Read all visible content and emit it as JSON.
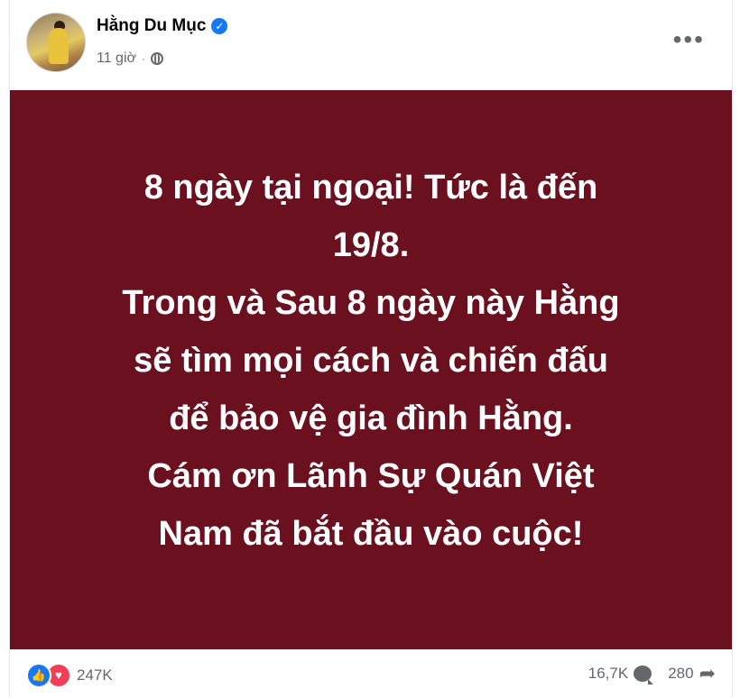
{
  "post": {
    "author": "Hằng Du Mục",
    "time": "11 giờ",
    "separator": "·",
    "verified_icon": "verified-badge-icon",
    "privacy_icon": "globe-icon",
    "more_label": "•••",
    "poster_lines": [
      "8 ngày tại ngoại! Tức là đến",
      "19/8.",
      "Trong và Sau 8 ngày này Hằng",
      "sẽ tìm mọi cách và chiến đấu",
      "để bảo vệ gia đình Hằng.",
      "Cám ơn Lãnh Sự Quán Việt",
      "Nam đã bắt đầu vào cuộc!"
    ]
  },
  "stats": {
    "reactions_count": "247K",
    "comments_count": "16,7K",
    "shares_count": "280"
  },
  "colors": {
    "poster_bg": "#6b101f",
    "accent": "#1877f2",
    "love": "#f33e58"
  }
}
